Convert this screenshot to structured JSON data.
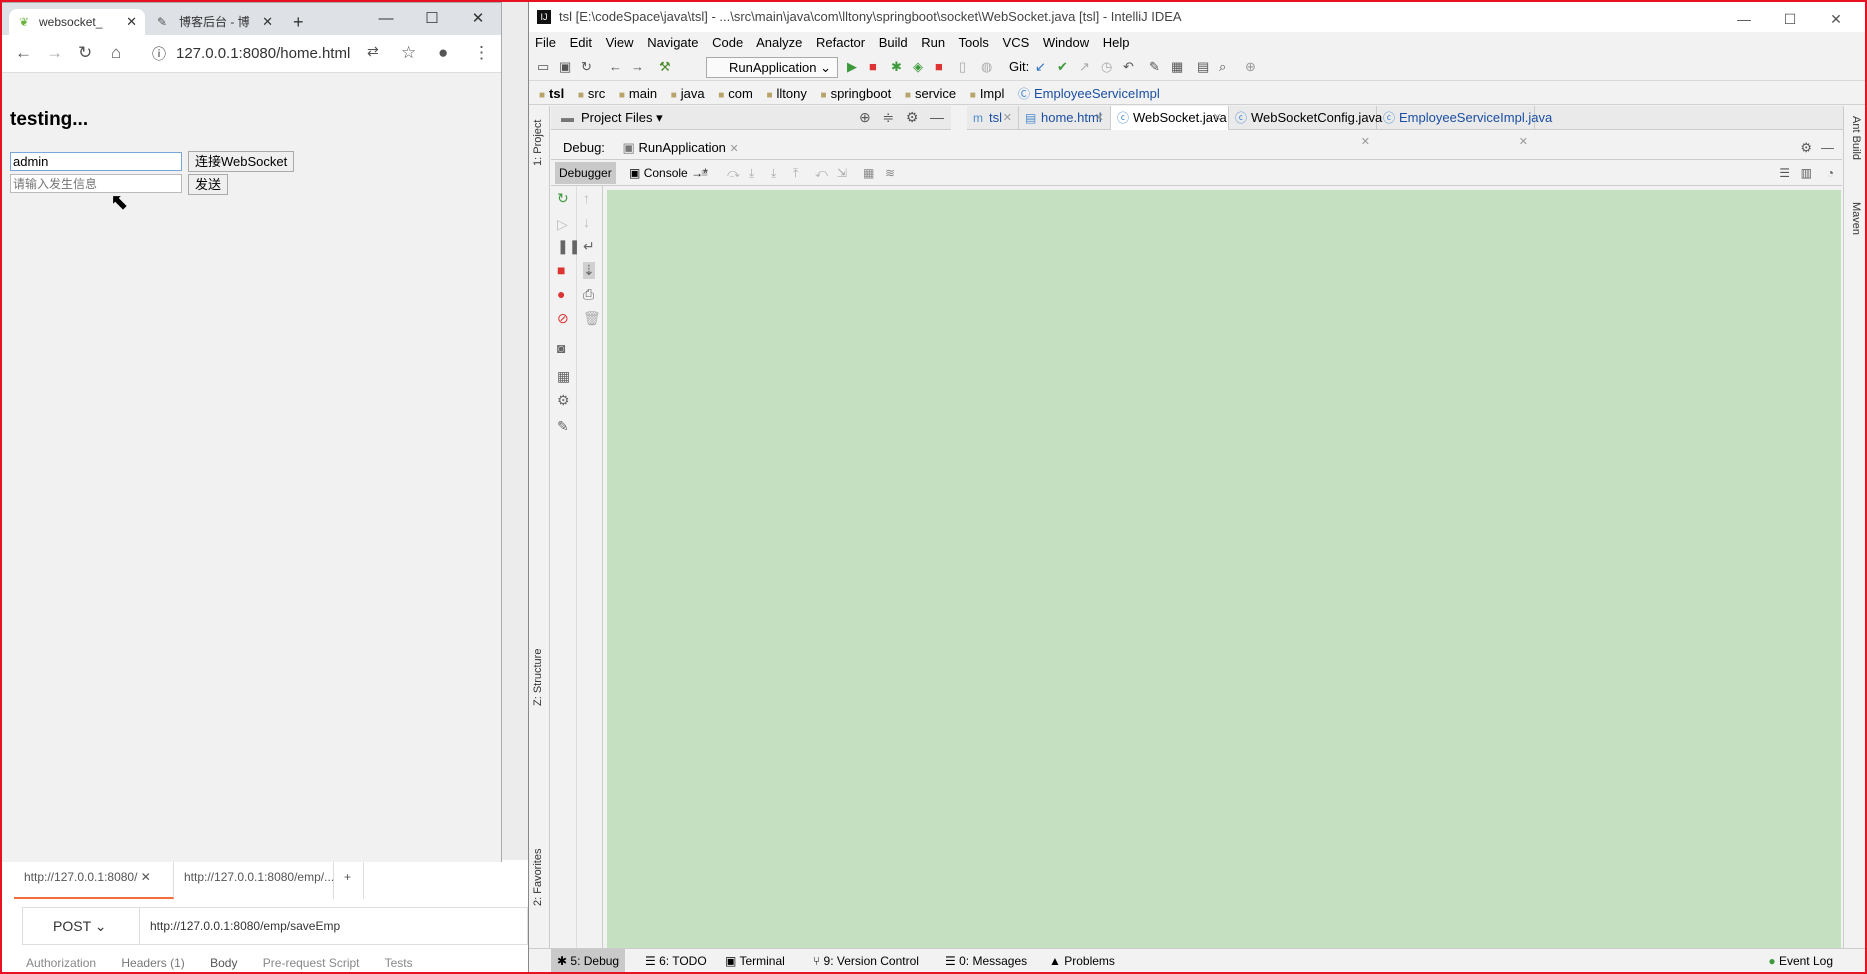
{
  "browser": {
    "tabs": [
      {
        "title": "websocket_"
      },
      {
        "title": "博客后台 - 博"
      }
    ],
    "url": "127.0.0.1:8080/home.html",
    "page": {
      "heading": "testing...",
      "username_value": "admin",
      "connect_button": "连接WebSocket",
      "message_placeholder": "请输入发生信息",
      "send_button": "发送"
    }
  },
  "postman": {
    "tabs": [
      "http://127.0.0.1:8080/",
      "http://127.0.0.1:8080/emp/..."
    ],
    "method": "POST",
    "url": "http://127.0.0.1:8080/emp/saveEmp",
    "subtabs": [
      "Authorization",
      "Headers (1)",
      "Body",
      "Pre-request Script",
      "Tests"
    ]
  },
  "idea": {
    "title": "tsl [E:\\codeSpace\\java\\tsl] - ...\\src\\main\\java\\com\\lltony\\springboot\\socket\\WebSocket.java [tsl] - IntelliJ IDEA",
    "menu": [
      "File",
      "Edit",
      "View",
      "Navigate",
      "Code",
      "Analyze",
      "Refactor",
      "Build",
      "Run",
      "Tools",
      "VCS",
      "Window",
      "Help"
    ],
    "run_config": "RunApplication",
    "git_label": "Git:",
    "breadcrumbs": [
      "tsl",
      "src",
      "main",
      "java",
      "com",
      "lltony",
      "springboot",
      "service",
      "Impl",
      "EmployeeServiceImpl"
    ],
    "project_panel": "Project Files",
    "editor_tabs": [
      {
        "label": "tsl",
        "active": false
      },
      {
        "label": "home.html",
        "active": false
      },
      {
        "label": "WebSocket.java",
        "active": true
      },
      {
        "label": "WebSocketConfig.java",
        "active": false
      },
      {
        "label": "EmployeeServiceImpl.java",
        "active": false
      }
    ],
    "debug_label": "Debug:",
    "debug_config": "RunApplication",
    "debug_tabs": [
      "Debugger",
      "Console"
    ],
    "left_tools": [
      "1: Project",
      "Z: Structure",
      "2: Favorites"
    ],
    "right_tools": [
      "Ant Build",
      "Maven"
    ],
    "status_tabs": [
      "5: Debug",
      "6: TODO",
      "Terminal",
      "9: Version Control",
      "0: Messages",
      "Problems"
    ],
    "event_log": "Event Log"
  },
  "colors": {
    "console_bg": "#c4e0c0",
    "frame_red": "#e81123"
  }
}
